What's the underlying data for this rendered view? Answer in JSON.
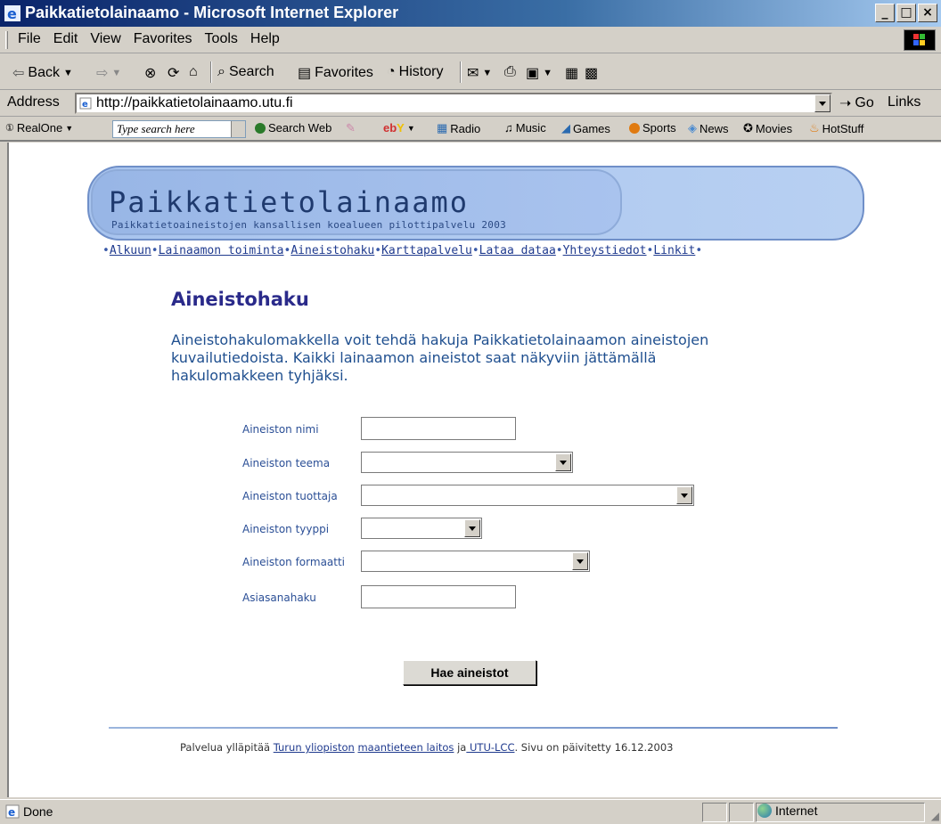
{
  "window": {
    "title": "Paikkatietolainaamo - Microsoft Internet Explorer"
  },
  "menu": {
    "items": [
      "File",
      "Edit",
      "View",
      "Favorites",
      "Tools",
      "Help"
    ]
  },
  "toolbar": {
    "back": "Back",
    "search": "Search",
    "favorites": "Favorites",
    "history": "History"
  },
  "address": {
    "label": "Address",
    "url": "http://paikkatietolainaamo.utu.fi",
    "go": "Go",
    "links": "Links"
  },
  "realone": {
    "brand": "RealOne",
    "search_placeholder": "Type search here",
    "search_web": "Search Web",
    "radio": "Radio",
    "music": "Music",
    "games": "Games",
    "sports": "Sports",
    "news": "News",
    "movies": "Movies",
    "hotstuff": "HotStuff"
  },
  "site": {
    "title": "Paikkatietolainaamo",
    "subtitle": "Paikkatietoaineistojen kansallisen koealueen pilottipalvelu 2003",
    "nav": [
      "Alkuun",
      "Lainaamon toiminta",
      "Aineistohaku",
      "Karttapalvelu",
      "Lataa dataa",
      "Yhteystiedot",
      "Linkit"
    ]
  },
  "page": {
    "heading": "Aineistohaku",
    "intro": "Aineistohakulomakkella voit tehdä hakuja Paikkatietolainaamon aineistojen kuvailutiedoista. Kaikki lainaamon aineistot saat näkyviin jättämällä hakulomakkeen tyhjäksi."
  },
  "form": {
    "name_label": "Aineiston nimi",
    "theme_label": "Aineiston teema",
    "producer_label": "Aineiston tuottaja",
    "type_label": "Aineiston tyyppi",
    "format_label": "Aineiston formaatti",
    "keyword_label": "Asiasanahaku",
    "submit": "Hae aineistot"
  },
  "footer": {
    "prefix": "Palvelua ylläpitää ",
    "link1": "Turun yliopiston",
    "link2": "maantieteen laitos",
    "mid": " ja",
    "link3": " UTU-LCC",
    "suffix": ". Sivu on päivitetty 16.12.2003"
  },
  "status": {
    "text": "Done",
    "zone": "Internet"
  }
}
